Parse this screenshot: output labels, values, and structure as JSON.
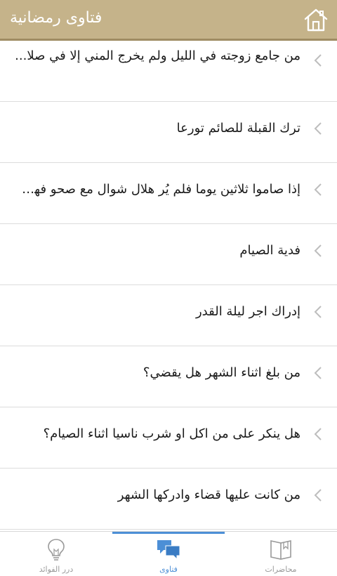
{
  "header": {
    "title": "فتاوى رمضانية",
    "home_icon": "home-icon"
  },
  "fatwas": [
    "من جامع زوجته في الليل ولم يخرج المني إلا في صلا...",
    "ترك القبلة للصائم تورعا",
    "إذا صاموا ثلاثين يوما فلم يُر هلال شوال مع صحو فهل...",
    "فدية الصيام",
    "إدراك اجر ليلة القدر",
    "من بلغ اثناء الشهر هل يقضي؟",
    "هل ينكر على من اكل او شرب ناسيا اثناء الصيام؟",
    "من كانت عليها قضاء وادركها الشهر"
  ],
  "tabs": {
    "benefits": "درر الفوائد",
    "fatwas": "فتاوى",
    "lectures": "محاضرات",
    "active": "fatwas"
  },
  "colors": {
    "header_bg": "#c5b38a",
    "accent": "#4c8fd6",
    "chevron": "#bdbdbd"
  }
}
